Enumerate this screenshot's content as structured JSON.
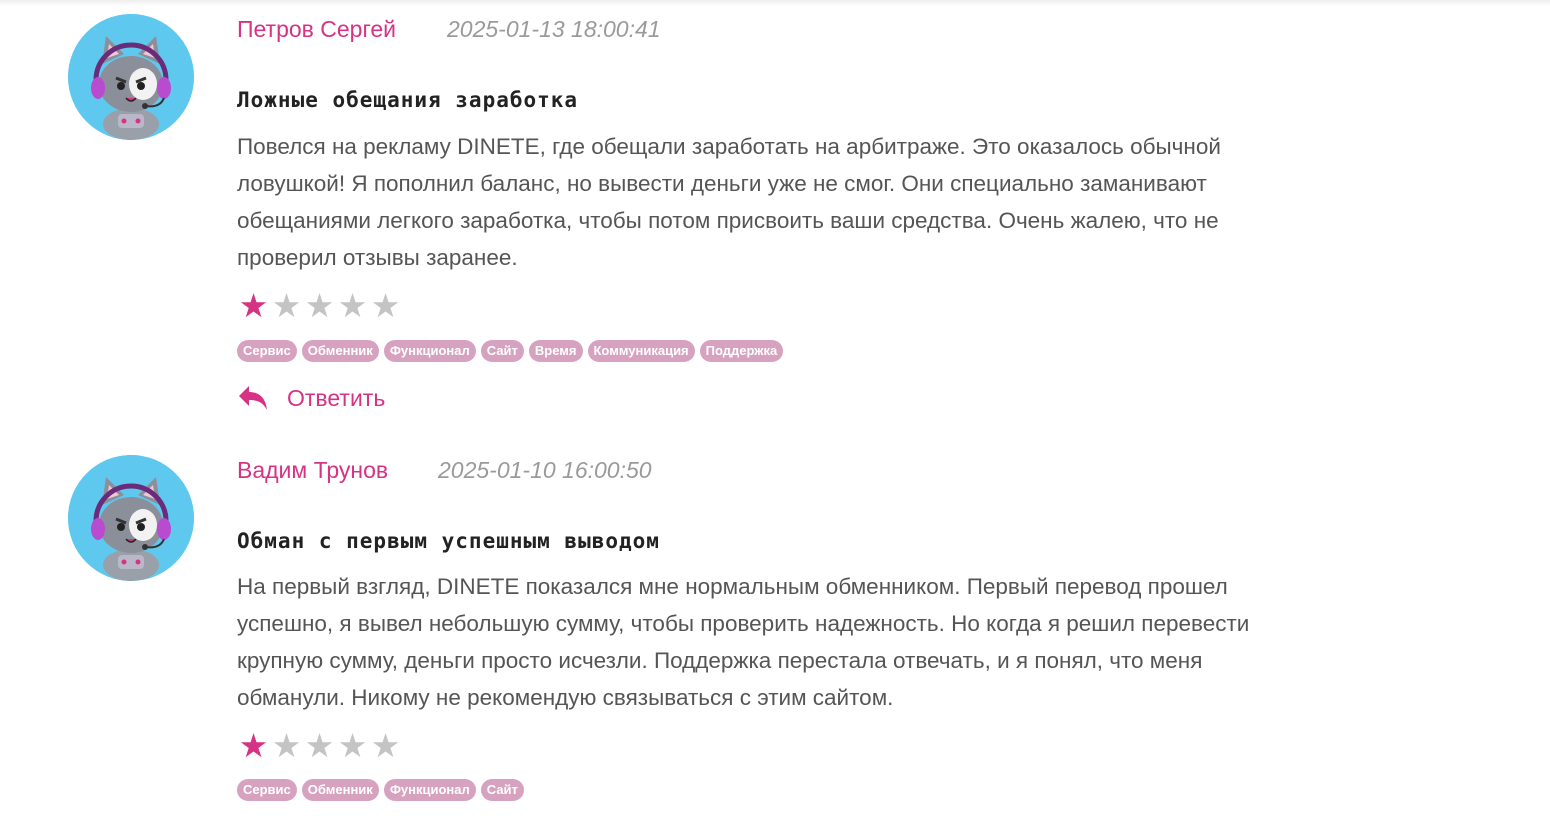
{
  "reviews": [
    {
      "author": "Петров Сергей",
      "date": "2025-01-13 18:00:41",
      "title": "Ложные обещания заработка",
      "text": "Повелся на рекламу DINETE, где обещали заработать на арбитраже. Это оказалось обычной ловушкой! Я пополнил баланс, но вывести деньги уже не смог. Они специально заманивают обещаниями легкого заработка, чтобы потом присвоить ваши средства. Очень жалею, что не проверил отзывы заранее.",
      "rating": 1,
      "rating_max": 5,
      "tags": [
        "Сервис",
        "Обменник",
        "Функционал",
        "Сайт",
        "Время",
        "Коммуникация",
        "Поддержка"
      ],
      "reply_label": "Ответить",
      "reply_icon": "reply-arrow-icon",
      "avatar_icon": "cat-gamer-avatar-icon"
    },
    {
      "author": "Вадим Трунов",
      "date": "2025-01-10 16:00:50",
      "title": "Обман с первым успешным выводом",
      "text": "На первый взгляд, DINETE показался мне нормальным обменником. Первый перевод прошел успешно, я вывел небольшую сумму, чтобы проверить надежность. Но когда я решил перевести крупную сумму, деньги просто исчезли. Поддержка перестала отвечать, и я понял, что меня обманули. Никому не рекомендую связываться с этим сайтом.",
      "rating": 1,
      "rating_max": 5,
      "tags": [
        "Сервис",
        "Обменник",
        "Функционал",
        "Сайт"
      ],
      "avatar_icon": "cat-gamer-avatar-icon"
    }
  ],
  "colors": {
    "accent": "#d63384",
    "tag_bg": "#d6a2c0",
    "star_off": "#c4c4c4",
    "avatar_bg": "#5fc8ef"
  }
}
